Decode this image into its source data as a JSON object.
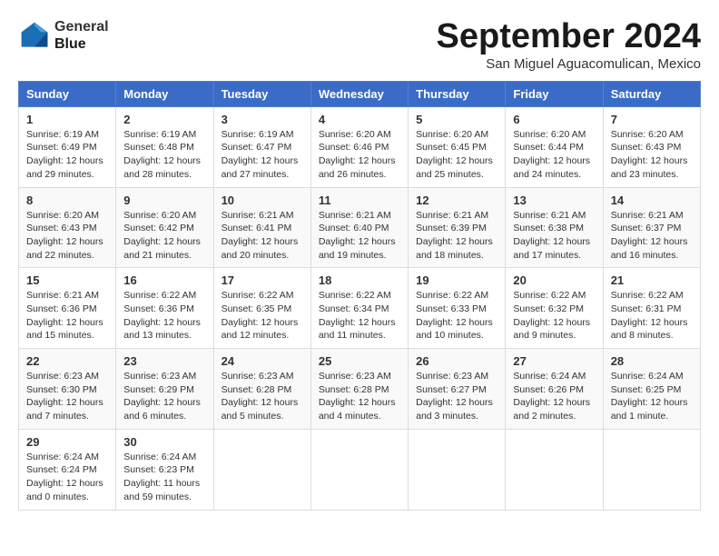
{
  "header": {
    "logo_line1": "General",
    "logo_line2": "Blue",
    "month_title": "September 2024",
    "location": "San Miguel Aguacomulican, Mexico"
  },
  "weekdays": [
    "Sunday",
    "Monday",
    "Tuesday",
    "Wednesday",
    "Thursday",
    "Friday",
    "Saturday"
  ],
  "weeks": [
    [
      {
        "day": "1",
        "sunrise": "6:19 AM",
        "sunset": "6:49 PM",
        "daylight": "12 hours and 29 minutes."
      },
      {
        "day": "2",
        "sunrise": "6:19 AM",
        "sunset": "6:48 PM",
        "daylight": "12 hours and 28 minutes."
      },
      {
        "day": "3",
        "sunrise": "6:19 AM",
        "sunset": "6:47 PM",
        "daylight": "12 hours and 27 minutes."
      },
      {
        "day": "4",
        "sunrise": "6:20 AM",
        "sunset": "6:46 PM",
        "daylight": "12 hours and 26 minutes."
      },
      {
        "day": "5",
        "sunrise": "6:20 AM",
        "sunset": "6:45 PM",
        "daylight": "12 hours and 25 minutes."
      },
      {
        "day": "6",
        "sunrise": "6:20 AM",
        "sunset": "6:44 PM",
        "daylight": "12 hours and 24 minutes."
      },
      {
        "day": "7",
        "sunrise": "6:20 AM",
        "sunset": "6:43 PM",
        "daylight": "12 hours and 23 minutes."
      }
    ],
    [
      {
        "day": "8",
        "sunrise": "6:20 AM",
        "sunset": "6:43 PM",
        "daylight": "12 hours and 22 minutes."
      },
      {
        "day": "9",
        "sunrise": "6:20 AM",
        "sunset": "6:42 PM",
        "daylight": "12 hours and 21 minutes."
      },
      {
        "day": "10",
        "sunrise": "6:21 AM",
        "sunset": "6:41 PM",
        "daylight": "12 hours and 20 minutes."
      },
      {
        "day": "11",
        "sunrise": "6:21 AM",
        "sunset": "6:40 PM",
        "daylight": "12 hours and 19 minutes."
      },
      {
        "day": "12",
        "sunrise": "6:21 AM",
        "sunset": "6:39 PM",
        "daylight": "12 hours and 18 minutes."
      },
      {
        "day": "13",
        "sunrise": "6:21 AM",
        "sunset": "6:38 PM",
        "daylight": "12 hours and 17 minutes."
      },
      {
        "day": "14",
        "sunrise": "6:21 AM",
        "sunset": "6:37 PM",
        "daylight": "12 hours and 16 minutes."
      }
    ],
    [
      {
        "day": "15",
        "sunrise": "6:21 AM",
        "sunset": "6:36 PM",
        "daylight": "12 hours and 15 minutes."
      },
      {
        "day": "16",
        "sunrise": "6:22 AM",
        "sunset": "6:36 PM",
        "daylight": "12 hours and 13 minutes."
      },
      {
        "day": "17",
        "sunrise": "6:22 AM",
        "sunset": "6:35 PM",
        "daylight": "12 hours and 12 minutes."
      },
      {
        "day": "18",
        "sunrise": "6:22 AM",
        "sunset": "6:34 PM",
        "daylight": "12 hours and 11 minutes."
      },
      {
        "day": "19",
        "sunrise": "6:22 AM",
        "sunset": "6:33 PM",
        "daylight": "12 hours and 10 minutes."
      },
      {
        "day": "20",
        "sunrise": "6:22 AM",
        "sunset": "6:32 PM",
        "daylight": "12 hours and 9 minutes."
      },
      {
        "day": "21",
        "sunrise": "6:22 AM",
        "sunset": "6:31 PM",
        "daylight": "12 hours and 8 minutes."
      }
    ],
    [
      {
        "day": "22",
        "sunrise": "6:23 AM",
        "sunset": "6:30 PM",
        "daylight": "12 hours and 7 minutes."
      },
      {
        "day": "23",
        "sunrise": "6:23 AM",
        "sunset": "6:29 PM",
        "daylight": "12 hours and 6 minutes."
      },
      {
        "day": "24",
        "sunrise": "6:23 AM",
        "sunset": "6:28 PM",
        "daylight": "12 hours and 5 minutes."
      },
      {
        "day": "25",
        "sunrise": "6:23 AM",
        "sunset": "6:28 PM",
        "daylight": "12 hours and 4 minutes."
      },
      {
        "day": "26",
        "sunrise": "6:23 AM",
        "sunset": "6:27 PM",
        "daylight": "12 hours and 3 minutes."
      },
      {
        "day": "27",
        "sunrise": "6:24 AM",
        "sunset": "6:26 PM",
        "daylight": "12 hours and 2 minutes."
      },
      {
        "day": "28",
        "sunrise": "6:24 AM",
        "sunset": "6:25 PM",
        "daylight": "12 hours and 1 minute."
      }
    ],
    [
      {
        "day": "29",
        "sunrise": "6:24 AM",
        "sunset": "6:24 PM",
        "daylight": "12 hours and 0 minutes."
      },
      {
        "day": "30",
        "sunrise": "6:24 AM",
        "sunset": "6:23 PM",
        "daylight": "11 hours and 59 minutes."
      },
      null,
      null,
      null,
      null,
      null
    ]
  ],
  "labels": {
    "sunrise_prefix": "Sunrise: ",
    "sunset_prefix": "Sunset: ",
    "daylight_prefix": "Daylight: "
  }
}
